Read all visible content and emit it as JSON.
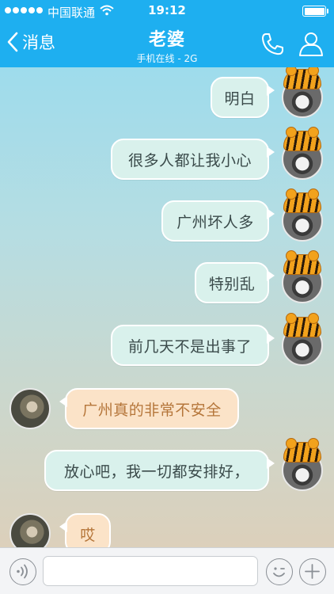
{
  "status_bar": {
    "carrier": "中国联通",
    "time": "19:12",
    "signal_bars": 5,
    "battery_level": 1.0
  },
  "nav": {
    "back_label": "消息",
    "title": "老婆",
    "subtitle": "手机在线 - 2G"
  },
  "messages": [
    {
      "sender": "me",
      "text": "明白"
    },
    {
      "sender": "me",
      "text": "很多人都让我小心"
    },
    {
      "sender": "me",
      "text": "广州坏人多"
    },
    {
      "sender": "me",
      "text": "特别乱"
    },
    {
      "sender": "me",
      "text": "前几天不是出事了"
    },
    {
      "sender": "her",
      "text": "广州真的非常不安全"
    },
    {
      "sender": "me",
      "text": "放心吧，我一切都安排好，"
    },
    {
      "sender": "her",
      "text": "哎"
    }
  ],
  "input": {
    "value": "",
    "placeholder": ""
  },
  "colors": {
    "nav_bg": "#1eaff0",
    "outgoing_bubble": "#d9f1ec",
    "incoming_bubble": "#fbe3c8",
    "incoming_text": "#b5763a"
  },
  "icons": {
    "back": "chevron-left-icon",
    "call": "phone-icon",
    "profile": "person-icon",
    "voice": "voice-icon",
    "emoji": "smiley-icon",
    "more": "plus-icon",
    "wifi": "wifi-icon"
  }
}
